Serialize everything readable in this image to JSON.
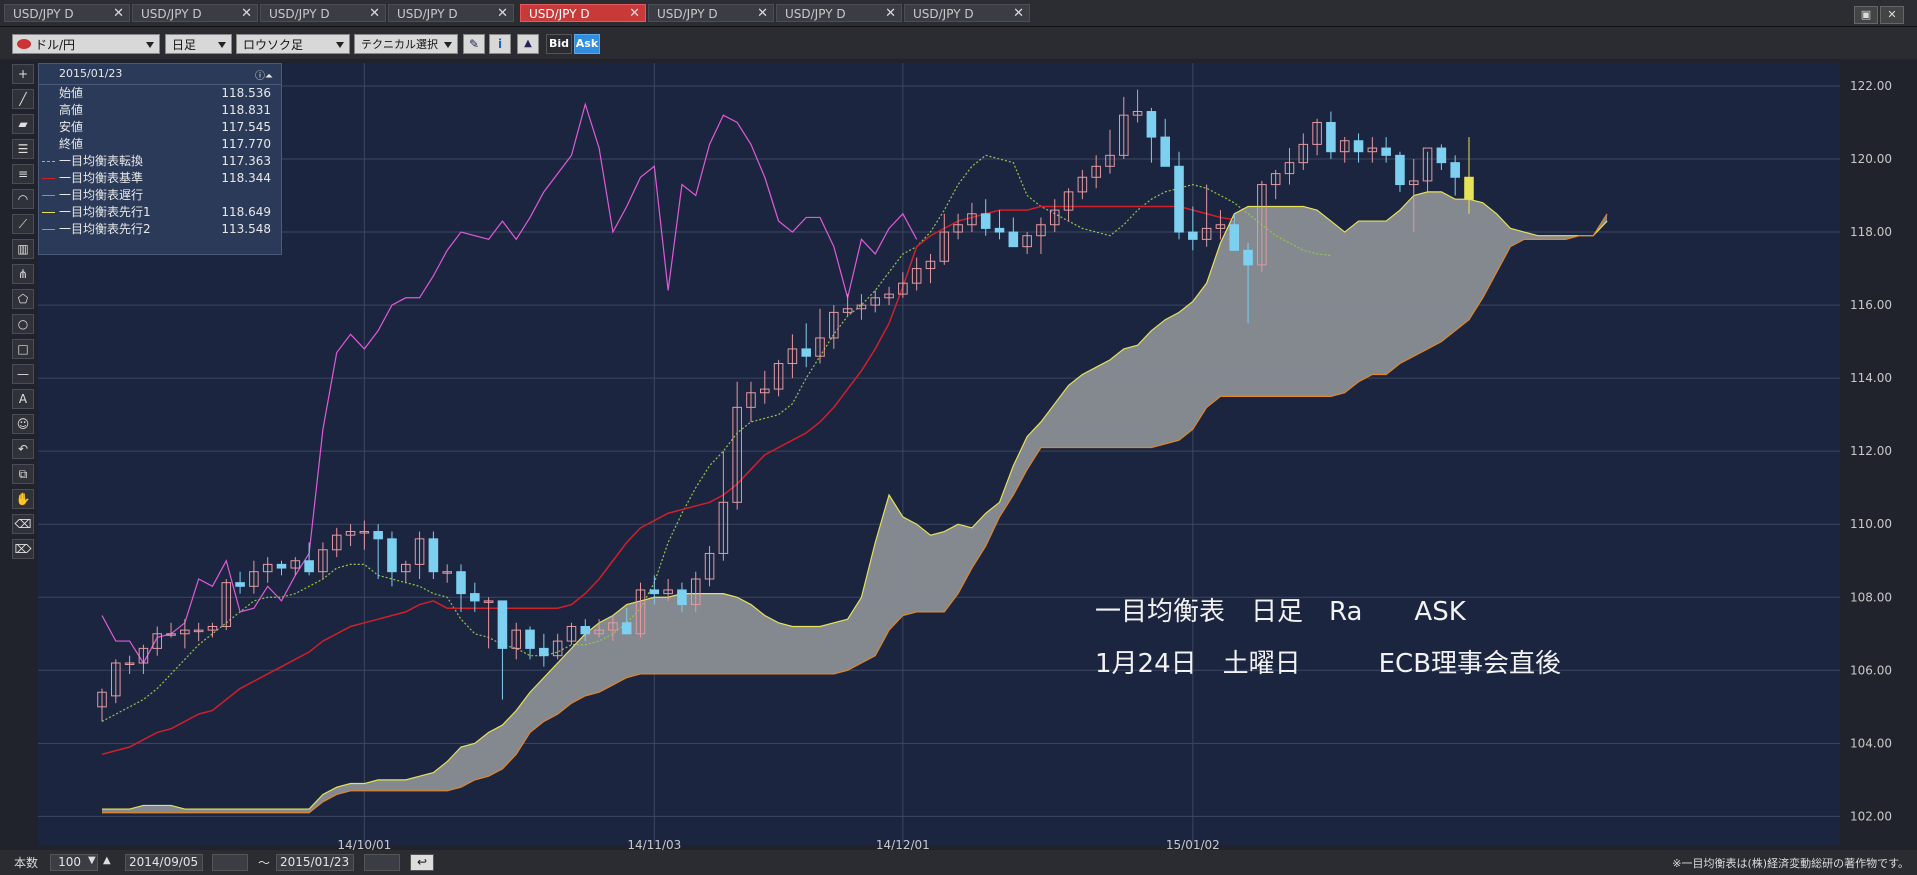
{
  "tabs": [
    {
      "label": "USD/JPY D",
      "active": false
    },
    {
      "label": "USD/JPY D",
      "active": false
    },
    {
      "label": "USD/JPY D",
      "active": false
    },
    {
      "label": "USD/JPY D",
      "active": false
    },
    {
      "label": "USD/JPY D",
      "active": true
    },
    {
      "label": "USD/JPY D",
      "active": false
    },
    {
      "label": "USD/JPY D",
      "active": false
    },
    {
      "label": "USD/JPY D",
      "active": false
    }
  ],
  "toolbar": {
    "symbol": "ドル/円",
    "period": "日足",
    "chart_style": "ロウソク足",
    "technical": "テクニカル選択",
    "bid_label": "Bid",
    "ask_label": "Ask"
  },
  "info_panel": {
    "date": "2015/01/23",
    "rows": [
      {
        "label": "始値",
        "value": "118.536",
        "color": ""
      },
      {
        "label": "高値",
        "value": "118.831",
        "color": ""
      },
      {
        "label": "安値",
        "value": "117.545",
        "color": ""
      },
      {
        "label": "終値",
        "value": "117.770",
        "color": ""
      },
      {
        "label": "一目均衡表転換",
        "value": "117.363",
        "color": "#8fc84a"
      },
      {
        "label": "一目均衡表基準",
        "value": "118.344",
        "color": "#d0202a"
      },
      {
        "label": "一目均衡表遅行",
        "value": "",
        "color": "#e05ad8"
      },
      {
        "label": "一目均衡表先行1",
        "value": "118.649",
        "color": "#e6e25a"
      },
      {
        "label": "一目均衡表先行2",
        "value": "113.548",
        "color": "#e0862a"
      }
    ]
  },
  "annotation": {
    "line1": "一目均衡表　日足　Ra　　ASK",
    "line2": "1月24日　土曜日　　　ECB理事会直後"
  },
  "status": {
    "count_label": "本数",
    "count_value": "100",
    "from_date": "2014/09/05",
    "tilde": "～",
    "to_date": "2015/01/23",
    "copyright": "※一目均衡表は(株)経済変動総研の著作物です。"
  },
  "colors": {
    "background": "#1b2540",
    "grid": "#3c4660",
    "bull_candle": "#e39aa0",
    "bear_candle": "#7ed0f0",
    "tenkan": "#8fc84a",
    "kijun": "#d0202a",
    "chikou": "#e05ad8",
    "senkou1": "#e6e25a",
    "senkou2": "#e0862a",
    "cloud": "#8a8d94",
    "last_candle": "#e6e25a"
  },
  "chart_data": {
    "type": "candlestick",
    "title": "",
    "xlabel": "",
    "ylabel": "",
    "ylim": [
      101.6,
      122.3
    ],
    "y_ticks": [
      "102.00",
      "104.00",
      "106.00",
      "108.00",
      "110.00",
      "112.00",
      "114.00",
      "116.00",
      "118.00",
      "120.00",
      "122.00"
    ],
    "x_ticks": [
      {
        "label": "14/10/01",
        "index": 19
      },
      {
        "label": "14/11/03",
        "index": 40
      },
      {
        "label": "14/12/01",
        "index": 58
      },
      {
        "label": "15/01/02",
        "index": 79
      }
    ],
    "n_total": 126,
    "candles": {
      "dates": [
        "2014-09-05",
        "2014-09-08",
        "2014-09-09",
        "2014-09-10",
        "2014-09-11",
        "2014-09-12",
        "2014-09-15",
        "2014-09-16",
        "2014-09-17",
        "2014-09-18",
        "2014-09-19",
        "2014-09-22",
        "2014-09-23",
        "2014-09-24",
        "2014-09-25",
        "2014-09-26",
        "2014-09-29",
        "2014-09-30",
        "2014-10-01",
        "2014-10-02",
        "2014-10-03",
        "2014-10-06",
        "2014-10-07",
        "2014-10-08",
        "2014-10-09",
        "2014-10-10",
        "2014-10-13",
        "2014-10-14",
        "2014-10-15",
        "2014-10-16",
        "2014-10-17",
        "2014-10-20",
        "2014-10-21",
        "2014-10-22",
        "2014-10-23",
        "2014-10-24",
        "2014-10-27",
        "2014-10-28",
        "2014-10-29",
        "2014-10-30",
        "2014-10-31",
        "2014-11-03",
        "2014-11-04",
        "2014-11-05",
        "2014-11-06",
        "2014-11-07",
        "2014-11-10",
        "2014-11-11",
        "2014-11-12",
        "2014-11-13",
        "2014-11-14",
        "2014-11-17",
        "2014-11-18",
        "2014-11-19",
        "2014-11-20",
        "2014-11-21",
        "2014-11-24",
        "2014-11-25",
        "2014-11-26",
        "2014-11-27",
        "2014-11-28",
        "2014-12-01",
        "2014-12-02",
        "2014-12-03",
        "2014-12-04",
        "2014-12-05",
        "2014-12-08",
        "2014-12-09",
        "2014-12-10",
        "2014-12-11",
        "2014-12-12",
        "2014-12-15",
        "2014-12-16",
        "2014-12-17",
        "2014-12-18",
        "2014-12-19",
        "2014-12-22",
        "2014-12-23",
        "2014-12-24",
        "2014-12-25",
        "2014-12-26",
        "2014-12-29",
        "2014-12-30",
        "2014-12-31",
        "2015-01-02",
        "2015-01-05",
        "2015-01-06",
        "2015-01-07",
        "2015-01-08",
        "2015-01-09",
        "2015-01-12",
        "2015-01-13",
        "2015-01-14",
        "2015-01-15",
        "2015-01-16",
        "2015-01-19",
        "2015-01-20",
        "2015-01-21",
        "2015-01-22",
        "2015-01-23"
      ],
      "open": [
        105.0,
        105.3,
        106.2,
        106.2,
        106.6,
        107.0,
        107.0,
        107.1,
        107.1,
        107.2,
        108.4,
        108.3,
        108.7,
        108.9,
        108.8,
        109.0,
        108.7,
        109.3,
        109.7,
        109.8,
        109.8,
        109.6,
        108.7,
        108.9,
        109.6,
        108.7,
        108.7,
        108.1,
        107.9,
        107.9,
        106.6,
        107.1,
        106.6,
        106.4,
        106.8,
        107.2,
        107.0,
        107.1,
        107.3,
        107.0,
        108.2,
        108.1,
        108.2,
        107.8,
        108.5,
        109.2,
        110.6,
        113.2,
        113.6,
        113.7,
        114.4,
        114.8,
        114.6,
        115.1,
        115.8,
        115.9,
        116.0,
        116.2,
        116.3,
        116.6,
        117.0,
        117.2,
        118.0,
        118.2,
        118.5,
        118.1,
        118.0,
        117.6,
        117.9,
        118.2,
        118.6,
        119.1,
        119.5,
        119.8,
        120.1,
        121.2,
        121.3,
        120.6,
        119.8,
        118.0,
        117.8,
        118.1,
        118.2,
        117.5,
        117.1,
        119.3,
        119.6,
        119.9,
        120.4,
        121.0,
        120.2,
        120.5,
        120.2,
        120.3,
        120.1,
        119.3,
        119.4,
        120.3,
        119.9,
        119.5
      ],
      "high": [
        105.5,
        106.3,
        106.4,
        106.7,
        107.2,
        107.3,
        107.4,
        107.3,
        107.3,
        108.5,
        108.7,
        109.0,
        109.1,
        109.0,
        109.1,
        109.5,
        109.5,
        109.9,
        110.0,
        110.1,
        110.0,
        109.8,
        109.0,
        109.8,
        109.8,
        108.9,
        108.9,
        108.4,
        108.0,
        107.2,
        107.3,
        107.2,
        107.0,
        107.0,
        107.3,
        107.4,
        107.4,
        107.5,
        107.7,
        108.4,
        108.6,
        108.5,
        108.4,
        108.7,
        109.4,
        112.0,
        113.9,
        113.9,
        114.2,
        114.5,
        115.2,
        115.5,
        115.9,
        116.0,
        116.3,
        116.3,
        116.4,
        116.5,
        116.9,
        117.3,
        117.4,
        118.5,
        118.5,
        118.8,
        118.9,
        118.6,
        118.4,
        118.0,
        118.4,
        118.9,
        119.2,
        119.7,
        120.1,
        120.8,
        121.7,
        121.9,
        121.4,
        121.1,
        120.2,
        118.7,
        119.3,
        118.6,
        118.5,
        117.7,
        119.4,
        119.7,
        120.3,
        120.7,
        121.1,
        121.3,
        120.6,
        120.7,
        120.6,
        120.6,
        120.2,
        120.0,
        120.2,
        120.4,
        120.1,
        120.6
      ],
      "low": [
        104.6,
        105.1,
        105.9,
        105.9,
        106.4,
        106.9,
        106.6,
        106.8,
        106.9,
        107.1,
        108.1,
        108.1,
        108.4,
        108.6,
        108.6,
        108.6,
        108.5,
        109.1,
        109.4,
        109.3,
        108.5,
        108.3,
        108.4,
        108.5,
        108.5,
        108.4,
        107.6,
        107.6,
        106.6,
        105.2,
        106.3,
        106.3,
        106.1,
        106.3,
        106.7,
        106.8,
        106.9,
        106.8,
        107.1,
        106.9,
        107.8,
        107.9,
        107.6,
        107.6,
        108.3,
        109.0,
        110.4,
        112.8,
        113.3,
        113.5,
        114.0,
        114.3,
        114.4,
        114.8,
        115.7,
        115.6,
        115.8,
        116.0,
        116.2,
        116.4,
        116.6,
        117.1,
        117.8,
        118.0,
        117.9,
        117.8,
        117.7,
        117.4,
        117.4,
        118.0,
        118.3,
        118.9,
        119.2,
        119.6,
        120.0,
        121.0,
        119.9,
        119.8,
        117.8,
        117.5,
        117.6,
        117.8,
        117.6,
        115.5,
        116.9,
        118.9,
        119.3,
        119.7,
        120.1,
        120.0,
        119.9,
        119.9,
        119.9,
        119.9,
        119.1,
        118.0,
        119.1,
        119.7,
        119.0,
        118.5
      ],
      "close": [
        105.4,
        106.2,
        106.2,
        106.6,
        107.0,
        107.0,
        107.1,
        107.1,
        107.2,
        108.4,
        108.3,
        108.7,
        108.9,
        108.8,
        109.0,
        108.7,
        109.3,
        109.7,
        109.8,
        109.8,
        109.6,
        108.7,
        108.9,
        109.6,
        108.7,
        108.7,
        108.1,
        107.9,
        107.9,
        106.6,
        107.1,
        106.6,
        106.4,
        106.8,
        107.2,
        107.0,
        107.1,
        107.3,
        107.0,
        108.2,
        108.1,
        108.2,
        107.8,
        108.5,
        109.2,
        110.6,
        113.2,
        113.6,
        113.7,
        114.4,
        114.8,
        114.6,
        115.1,
        115.8,
        115.9,
        116.0,
        116.2,
        116.3,
        116.6,
        117.0,
        117.2,
        118.0,
        118.2,
        118.5,
        118.1,
        118.0,
        117.6,
        117.9,
        118.2,
        118.6,
        119.1,
        119.5,
        119.8,
        120.1,
        121.2,
        121.3,
        120.6,
        119.8,
        118.0,
        117.8,
        118.1,
        118.2,
        117.5,
        117.1,
        119.3,
        119.6,
        119.9,
        120.4,
        121.0,
        120.2,
        120.5,
        120.2,
        120.3,
        120.1,
        119.3,
        119.4,
        120.3,
        119.9,
        119.5,
        118.9
      ]
    },
    "series": [
      {
        "name": "一目均衡表転換",
        "start_index": 0,
        "values": [
          104.6,
          104.8,
          105.0,
          105.2,
          105.5,
          105.9,
          106.3,
          106.7,
          107.0,
          107.3,
          107.6,
          107.9,
          108.0,
          108.0,
          108.1,
          108.3,
          108.5,
          108.8,
          108.9,
          108.9,
          108.6,
          108.5,
          108.4,
          108.3,
          108.1,
          108.0,
          107.4,
          107.0,
          106.9,
          106.7,
          106.6,
          106.4,
          106.4,
          106.5,
          106.7,
          106.7,
          106.8,
          107.0,
          107.3,
          107.7,
          108.4,
          109.5,
          110.3,
          111.0,
          111.6,
          112.0,
          112.5,
          112.8,
          112.9,
          113.0,
          113.3,
          114.0,
          114.6,
          115.2,
          115.7,
          116.0,
          116.4,
          116.9,
          117.4,
          117.6,
          118.0,
          118.6,
          119.3,
          119.8,
          120.1,
          120.0,
          119.9,
          119.0,
          118.7,
          118.5,
          118.3,
          118.1,
          118.0,
          117.9,
          118.2,
          118.6,
          118.9,
          119.1,
          119.2,
          119.3,
          119.2,
          119.0,
          118.8,
          118.5,
          118.2,
          117.9,
          117.7,
          117.5,
          117.4,
          117.36
        ]
      },
      {
        "name": "一目均衡表基準",
        "start_index": 0,
        "values": [
          103.7,
          103.8,
          103.9,
          104.1,
          104.3,
          104.4,
          104.6,
          104.8,
          104.9,
          105.2,
          105.5,
          105.7,
          105.9,
          106.1,
          106.3,
          106.5,
          106.8,
          107.0,
          107.2,
          107.3,
          107.4,
          107.5,
          107.6,
          107.8,
          107.9,
          107.7,
          107.7,
          107.7,
          107.7,
          107.7,
          107.7,
          107.7,
          107.7,
          107.7,
          107.8,
          108.1,
          108.5,
          109.0,
          109.5,
          109.9,
          110.1,
          110.3,
          110.4,
          110.5,
          110.6,
          110.8,
          111.1,
          111.5,
          111.9,
          112.1,
          112.3,
          112.5,
          112.8,
          113.2,
          113.7,
          114.2,
          114.8,
          115.5,
          116.5,
          117.6,
          117.9,
          118.1,
          118.3,
          118.4,
          118.5,
          118.6,
          118.6,
          118.6,
          118.7,
          118.7,
          118.7,
          118.7,
          118.7,
          118.7,
          118.7,
          118.7,
          118.7,
          118.7,
          118.7,
          118.6,
          118.5,
          118.4,
          118.34
        ]
      },
      {
        "name": "一目均衡表遅行",
        "start_index": 0,
        "values": [
          107.5,
          106.8,
          106.8,
          106.2,
          106.9,
          107.0,
          107.3,
          108.5,
          108.3,
          109.0,
          107.6,
          107.7,
          108.3,
          107.9,
          108.6,
          109.2,
          112.6,
          114.7,
          115.2,
          114.8,
          115.3,
          116.0,
          116.2,
          116.2,
          116.8,
          117.5,
          118.0,
          117.9,
          117.8,
          118.3,
          117.8,
          118.4,
          119.1,
          119.6,
          120.1,
          121.5,
          120.3,
          118.0,
          118.7,
          119.5,
          119.8,
          116.4,
          119.3,
          119.0,
          120.4,
          121.2,
          121.0,
          120.4,
          119.5,
          118.3,
          118.0,
          118.4,
          118.4,
          117.6,
          116.2,
          117.8,
          117.4,
          118.1,
          118.5,
          117.8
        ]
      },
      {
        "name": "一目均衡表先行1",
        "start_index": 0,
        "values": [
          102.2,
          102.2,
          102.2,
          102.3,
          102.3,
          102.3,
          102.2,
          102.2,
          102.2,
          102.2,
          102.2,
          102.2,
          102.2,
          102.2,
          102.2,
          102.2,
          102.6,
          102.8,
          102.9,
          102.9,
          103.0,
          103.0,
          103.0,
          103.1,
          103.2,
          103.5,
          103.9,
          104.0,
          104.3,
          104.5,
          104.9,
          105.4,
          105.8,
          106.2,
          106.6,
          107.0,
          107.3,
          107.5,
          107.8,
          107.9,
          108.0,
          108.0,
          108.1,
          108.1,
          108.1,
          108.1,
          108.0,
          107.8,
          107.5,
          107.3,
          107.2,
          107.2,
          107.2,
          107.3,
          107.4,
          108.0,
          109.5,
          110.8,
          110.2,
          110.0,
          109.7,
          109.8,
          110.0,
          109.9,
          110.3,
          110.6,
          111.6,
          112.4,
          112.8,
          113.3,
          113.8,
          114.1,
          114.3,
          114.5,
          114.8,
          114.9,
          115.3,
          115.6,
          115.8,
          116.1,
          116.6,
          117.7,
          118.5,
          118.7,
          118.7,
          118.7,
          118.7,
          118.7,
          118.6,
          118.3,
          118.0,
          118.3,
          118.3,
          118.3,
          118.6,
          119.0,
          119.1,
          119.1,
          118.9,
          118.9,
          118.8,
          118.5,
          118.1,
          118.0,
          117.9,
          117.9,
          117.9,
          117.9,
          117.9,
          118.3
        ]
      },
      {
        "name": "一目均衡表先行2",
        "start_index": 0,
        "values": [
          102.1,
          102.1,
          102.1,
          102.1,
          102.1,
          102.1,
          102.1,
          102.1,
          102.1,
          102.1,
          102.1,
          102.1,
          102.1,
          102.1,
          102.1,
          102.1,
          102.4,
          102.6,
          102.7,
          102.7,
          102.7,
          102.7,
          102.7,
          102.7,
          102.7,
          102.7,
          102.8,
          103.0,
          103.1,
          103.3,
          103.7,
          104.3,
          104.6,
          104.8,
          105.1,
          105.3,
          105.4,
          105.6,
          105.8,
          105.9,
          105.9,
          105.9,
          105.9,
          105.9,
          105.9,
          105.9,
          105.9,
          105.9,
          105.9,
          105.9,
          105.9,
          105.9,
          105.9,
          105.9,
          106.0,
          106.2,
          106.4,
          107.1,
          107.5,
          107.6,
          107.6,
          107.6,
          108.1,
          108.8,
          109.4,
          110.2,
          110.8,
          111.5,
          112.1,
          112.1,
          112.1,
          112.1,
          112.1,
          112.1,
          112.1,
          112.1,
          112.1,
          112.2,
          112.3,
          112.6,
          113.2,
          113.5,
          113.5,
          113.5,
          113.5,
          113.5,
          113.5,
          113.5,
          113.5,
          113.5,
          113.6,
          113.9,
          114.1,
          114.1,
          114.4,
          114.6,
          114.8,
          115.0,
          115.3,
          115.6,
          116.2,
          116.9,
          117.6,
          117.8,
          117.8,
          117.8,
          117.8,
          117.9,
          117.9,
          118.5
        ]
      }
    ]
  }
}
